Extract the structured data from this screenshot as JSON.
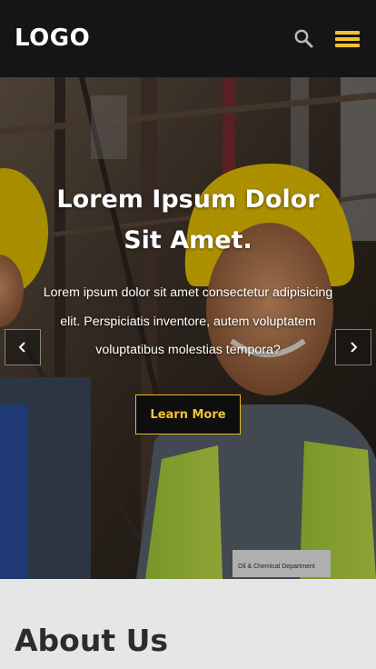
{
  "header": {
    "logo": "LOGO",
    "search_icon": "search-icon",
    "menu_icon": "hamburger-menu-icon"
  },
  "hero": {
    "title": "Lorem Ipsum Dolor Sit Amet.",
    "text": "Lorem ipsum dolor sit amet consectetur adipisicing elit. Perspiciatis inventore, autem voluptatem voluptatibus molestias tempora?",
    "button_label": "Learn More",
    "prev_icon": "chevron-left-icon",
    "next_icon": "chevron-right-icon",
    "image_label": "Oil & Chemical Department"
  },
  "about": {
    "title": "About Us"
  },
  "colors": {
    "header_bg": "#151515",
    "accent": "#f2c233",
    "page_bg": "#e6e6e6",
    "heading": "#2c2c2c"
  }
}
